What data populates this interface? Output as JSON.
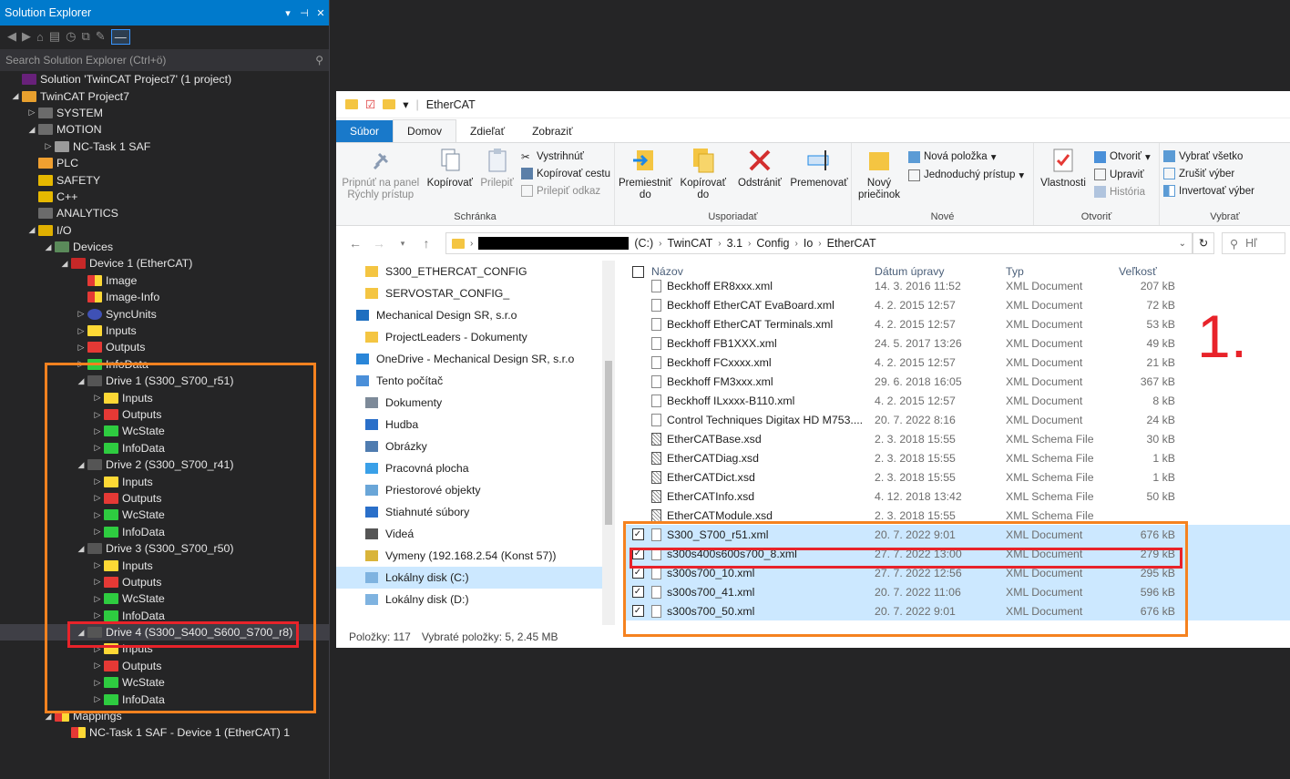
{
  "solution_explorer": {
    "title": "Solution Explorer",
    "search_placeholder": "Search Solution Explorer (Ctrl+ö)",
    "tree": [
      {
        "indent": 0,
        "arrow": "",
        "icon": "sol",
        "label": "Solution 'TwinCAT Project7' (1 project)"
      },
      {
        "indent": 0,
        "arrow": "◢",
        "icon": "proj",
        "label": "TwinCAT Project7"
      },
      {
        "indent": 1,
        "arrow": "▷",
        "icon": "sys",
        "label": "SYSTEM"
      },
      {
        "indent": 1,
        "arrow": "◢",
        "icon": "sys",
        "label": "MOTION"
      },
      {
        "indent": 2,
        "arrow": "▷",
        "icon": "task",
        "label": "NC-Task 1 SAF"
      },
      {
        "indent": 1,
        "arrow": "",
        "icon": "plc",
        "label": "PLC"
      },
      {
        "indent": 1,
        "arrow": "",
        "icon": "safe",
        "label": "SAFETY"
      },
      {
        "indent": 1,
        "arrow": "",
        "icon": "cpp",
        "label": "C++"
      },
      {
        "indent": 1,
        "arrow": "",
        "icon": "sys",
        "label": "ANALYTICS"
      },
      {
        "indent": 1,
        "arrow": "◢",
        "icon": "io",
        "label": "I/O"
      },
      {
        "indent": 2,
        "arrow": "◢",
        "icon": "dev",
        "label": "Devices"
      },
      {
        "indent": 3,
        "arrow": "◢",
        "icon": "ec",
        "label": "Device 1 (EtherCAT)"
      },
      {
        "indent": 4,
        "arrow": "",
        "icon": "img",
        "label": "Image"
      },
      {
        "indent": 4,
        "arrow": "",
        "icon": "img",
        "label": "Image-Info"
      },
      {
        "indent": 4,
        "arrow": "▷",
        "icon": "sync",
        "label": "SyncUnits"
      },
      {
        "indent": 4,
        "arrow": "▷",
        "icon": "in",
        "label": "Inputs"
      },
      {
        "indent": 4,
        "arrow": "▷",
        "icon": "out",
        "label": "Outputs"
      },
      {
        "indent": 4,
        "arrow": "▷",
        "icon": "green",
        "label": "InfoData"
      },
      {
        "indent": 4,
        "arrow": "◢",
        "icon": "drv",
        "label": "Drive 1 (S300_S700_r51)"
      },
      {
        "indent": 5,
        "arrow": "▷",
        "icon": "in",
        "label": "Inputs"
      },
      {
        "indent": 5,
        "arrow": "▷",
        "icon": "out",
        "label": "Outputs"
      },
      {
        "indent": 5,
        "arrow": "▷",
        "icon": "green",
        "label": "WcState"
      },
      {
        "indent": 5,
        "arrow": "▷",
        "icon": "green",
        "label": "InfoData"
      },
      {
        "indent": 4,
        "arrow": "◢",
        "icon": "drv",
        "label": "Drive 2 (S300_S700_r41)"
      },
      {
        "indent": 5,
        "arrow": "▷",
        "icon": "in",
        "label": "Inputs"
      },
      {
        "indent": 5,
        "arrow": "▷",
        "icon": "out",
        "label": "Outputs"
      },
      {
        "indent": 5,
        "arrow": "▷",
        "icon": "green",
        "label": "WcState"
      },
      {
        "indent": 5,
        "arrow": "▷",
        "icon": "green",
        "label": "InfoData"
      },
      {
        "indent": 4,
        "arrow": "◢",
        "icon": "drv",
        "label": "Drive 3 (S300_S700_r50)"
      },
      {
        "indent": 5,
        "arrow": "▷",
        "icon": "in",
        "label": "Inputs"
      },
      {
        "indent": 5,
        "arrow": "▷",
        "icon": "out",
        "label": "Outputs"
      },
      {
        "indent": 5,
        "arrow": "▷",
        "icon": "green",
        "label": "WcState"
      },
      {
        "indent": 5,
        "arrow": "▷",
        "icon": "green",
        "label": "InfoData"
      },
      {
        "indent": 4,
        "arrow": "◢",
        "icon": "drv",
        "label": "Drive 4 (S300_S400_S600_S700_r8)",
        "selected": true
      },
      {
        "indent": 5,
        "arrow": "▷",
        "icon": "in",
        "label": "Inputs"
      },
      {
        "indent": 5,
        "arrow": "▷",
        "icon": "out",
        "label": "Outputs"
      },
      {
        "indent": 5,
        "arrow": "▷",
        "icon": "green",
        "label": "WcState"
      },
      {
        "indent": 5,
        "arrow": "▷",
        "icon": "green",
        "label": "InfoData"
      },
      {
        "indent": 2,
        "arrow": "◢",
        "icon": "map",
        "label": "Mappings"
      },
      {
        "indent": 3,
        "arrow": "",
        "icon": "map",
        "label": "NC-Task 1 SAF - Device 1 (EtherCAT) 1"
      }
    ]
  },
  "explorer": {
    "title": "EtherCAT",
    "tabs": [
      "Súbor",
      "Domov",
      "Zdieľať",
      "Zobraziť"
    ],
    "ribbon": {
      "schranka": {
        "caption": "Schránka",
        "pin": "Pripnúť na panel Rýchly prístup",
        "copy": "Kopírovať",
        "paste": "Prilepiť",
        "cut": "Vystrihnúť",
        "copy_path": "Kopírovať cestu",
        "paste_link": "Prilepiť odkaz"
      },
      "usporiadat": {
        "caption": "Usporiadať",
        "move": "Premiestniť do",
        "copyto": "Kopírovať do",
        "delete": "Odstrániť",
        "rename": "Premenovať"
      },
      "nove": {
        "caption": "Nové",
        "new_folder": "Nový priečinok",
        "new_item": "Nová položka",
        "easy_access": "Jednoduchý prístup"
      },
      "otvorit": {
        "caption": "Otvoriť",
        "properties": "Vlastnosti",
        "open": "Otvoriť",
        "edit": "Upraviť",
        "history": "História"
      },
      "vybrat": {
        "caption": "Vybrať",
        "select_all": "Vybrať všetko",
        "select_none": "Zrušiť výber",
        "invert": "Invertovať výber"
      }
    },
    "address": [
      "(C:)",
      "TwinCAT",
      "3.1",
      "Config",
      "Io",
      "EtherCAT"
    ],
    "search_placeholder": "Hľ",
    "nav_items": [
      {
        "label": "S300_ETHERCAT_CONFIG",
        "icon": "folder",
        "indent": 1
      },
      {
        "label": "SERVOSTAR_CONFIG_",
        "icon": "folder",
        "indent": 1
      },
      {
        "label": "Mechanical Design SR, s.r.o",
        "icon": "org",
        "indent": 0
      },
      {
        "label": "ProjectLeaders - Dokumenty",
        "icon": "folder",
        "indent": 1
      },
      {
        "label": "OneDrive - Mechanical Design SR, s.r.o",
        "icon": "cloud",
        "indent": 0
      },
      {
        "label": "Tento počítač",
        "icon": "pc",
        "indent": 0
      },
      {
        "label": "Dokumenty",
        "icon": "doc",
        "indent": 1
      },
      {
        "label": "Hudba",
        "icon": "music",
        "indent": 1
      },
      {
        "label": "Obrázky",
        "icon": "pic",
        "indent": 1
      },
      {
        "label": "Pracovná plocha",
        "icon": "desk",
        "indent": 1
      },
      {
        "label": "Priestorové objekty",
        "icon": "3d",
        "indent": 1
      },
      {
        "label": "Stiahnuté súbory",
        "icon": "dl",
        "indent": 1
      },
      {
        "label": "Videá",
        "icon": "vid",
        "indent": 1
      },
      {
        "label": "Vymeny (192.168.2.54 (Konst 57))",
        "icon": "net",
        "indent": 1
      },
      {
        "label": "Lokálny disk (C:)",
        "icon": "disk",
        "indent": 1,
        "selected": true
      },
      {
        "label": "Lokálny disk (D:)",
        "icon": "disk",
        "indent": 1
      }
    ],
    "columns": [
      "Názov",
      "Dátum úpravy",
      "Typ",
      "Veľkosť"
    ],
    "files": [
      {
        "name": "Beckhoff ER8xxx.xml",
        "date": "14. 3. 2016 11:52",
        "type": "XML Document",
        "size": "207 kB",
        "kind": "xml"
      },
      {
        "name": "Beckhoff EtherCAT EvaBoard.xml",
        "date": "4. 2. 2015 12:57",
        "type": "XML Document",
        "size": "72 kB",
        "kind": "xml"
      },
      {
        "name": "Beckhoff EtherCAT Terminals.xml",
        "date": "4. 2. 2015 12:57",
        "type": "XML Document",
        "size": "53 kB",
        "kind": "xml"
      },
      {
        "name": "Beckhoff FB1XXX.xml",
        "date": "24. 5. 2017 13:26",
        "type": "XML Document",
        "size": "49 kB",
        "kind": "xml"
      },
      {
        "name": "Beckhoff FCxxxx.xml",
        "date": "4. 2. 2015 12:57",
        "type": "XML Document",
        "size": "21 kB",
        "kind": "xml"
      },
      {
        "name": "Beckhoff FM3xxx.xml",
        "date": "29. 6. 2018 16:05",
        "type": "XML Document",
        "size": "367 kB",
        "kind": "xml"
      },
      {
        "name": "Beckhoff ILxxxx-B110.xml",
        "date": "4. 2. 2015 12:57",
        "type": "XML Document",
        "size": "8 kB",
        "kind": "xml"
      },
      {
        "name": "Control Techniques Digitax HD M753....",
        "date": "20. 7. 2022 8:16",
        "type": "XML Document",
        "size": "24 kB",
        "kind": "xml"
      },
      {
        "name": "EtherCATBase.xsd",
        "date": "2. 3. 2018 15:55",
        "type": "XML Schema File",
        "size": "30 kB",
        "kind": "xsd"
      },
      {
        "name": "EtherCATDiag.xsd",
        "date": "2. 3. 2018 15:55",
        "type": "XML Schema File",
        "size": "1 kB",
        "kind": "xsd"
      },
      {
        "name": "EtherCATDict.xsd",
        "date": "2. 3. 2018 15:55",
        "type": "XML Schema File",
        "size": "1 kB",
        "kind": "xsd"
      },
      {
        "name": "EtherCATInfo.xsd",
        "date": "4. 12. 2018 13:42",
        "type": "XML Schema File",
        "size": "50 kB",
        "kind": "xsd"
      },
      {
        "name": "EtherCATModule.xsd",
        "date": "2. 3. 2018 15:55",
        "type": "XML Schema File",
        "size": "",
        "kind": "xsd"
      },
      {
        "name": "S300_S700_r51.xml",
        "date": "20. 7. 2022 9:01",
        "type": "XML Document",
        "size": "676 kB",
        "kind": "xml",
        "checked": true
      },
      {
        "name": "s300s400s600s700_8.xml",
        "date": "27. 7. 2022 13:00",
        "type": "XML Document",
        "size": "279 kB",
        "kind": "xml",
        "checked": true
      },
      {
        "name": "s300s700_10.xml",
        "date": "27. 7. 2022 12:56",
        "type": "XML Document",
        "size": "295 kB",
        "kind": "xml",
        "checked": true
      },
      {
        "name": "s300s700_41.xml",
        "date": "20. 7. 2022 11:06",
        "type": "XML Document",
        "size": "596 kB",
        "kind": "xml",
        "checked": true
      },
      {
        "name": "s300s700_50.xml",
        "date": "20. 7. 2022 9:01",
        "type": "XML Document",
        "size": "676 kB",
        "kind": "xml",
        "checked": true
      }
    ],
    "status": {
      "count": "Položky: 117",
      "selected": "Vybraté položky: 5, 2.45 MB"
    }
  },
  "annotation": {
    "step": "1.",
    "orange": "#f5821f",
    "red": "#e8232a"
  }
}
